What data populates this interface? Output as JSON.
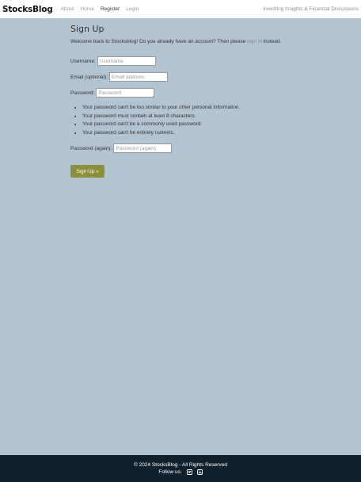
{
  "navbar": {
    "brand": "StocksBlog",
    "links": [
      {
        "label": "About"
      },
      {
        "label": "Home"
      },
      {
        "label": "Register"
      },
      {
        "label": "Login"
      }
    ],
    "tagline": "Investing Insights & Financial Discussions"
  },
  "main": {
    "title": "Sign Up",
    "welcome_prefix": "Welcome back to Stocksblog! Do you already have an account? Then please",
    "signin_link": "sign in",
    "welcome_suffix": "instead.",
    "fields": {
      "username": {
        "label": "Username:",
        "placeholder": "Username"
      },
      "email": {
        "label": "Email (optional):",
        "placeholder": "Email address"
      },
      "password": {
        "label": "Password:",
        "placeholder": "Password"
      },
      "password2": {
        "label": "Password (again):",
        "placeholder": "Password (again)"
      }
    },
    "help_items": [
      "Your password can't be too similar to your other personal information.",
      "Your password must contain at least 8 characters.",
      "Your password can't be a commonly used password.",
      "Your password can't be entirely numeric."
    ],
    "submit_label": "Sign Up »"
  },
  "footer": {
    "copyright": "© 2024 StocksBlog - All Rights Reserved",
    "follow_label": "Follow us:",
    "icons": [
      "twitter-icon",
      "linkedin-icon"
    ]
  },
  "colors": {
    "background": "#b2c4d2",
    "navbar": "#ffffff",
    "footer": "#0f212e",
    "button": "#8b8f3c"
  }
}
